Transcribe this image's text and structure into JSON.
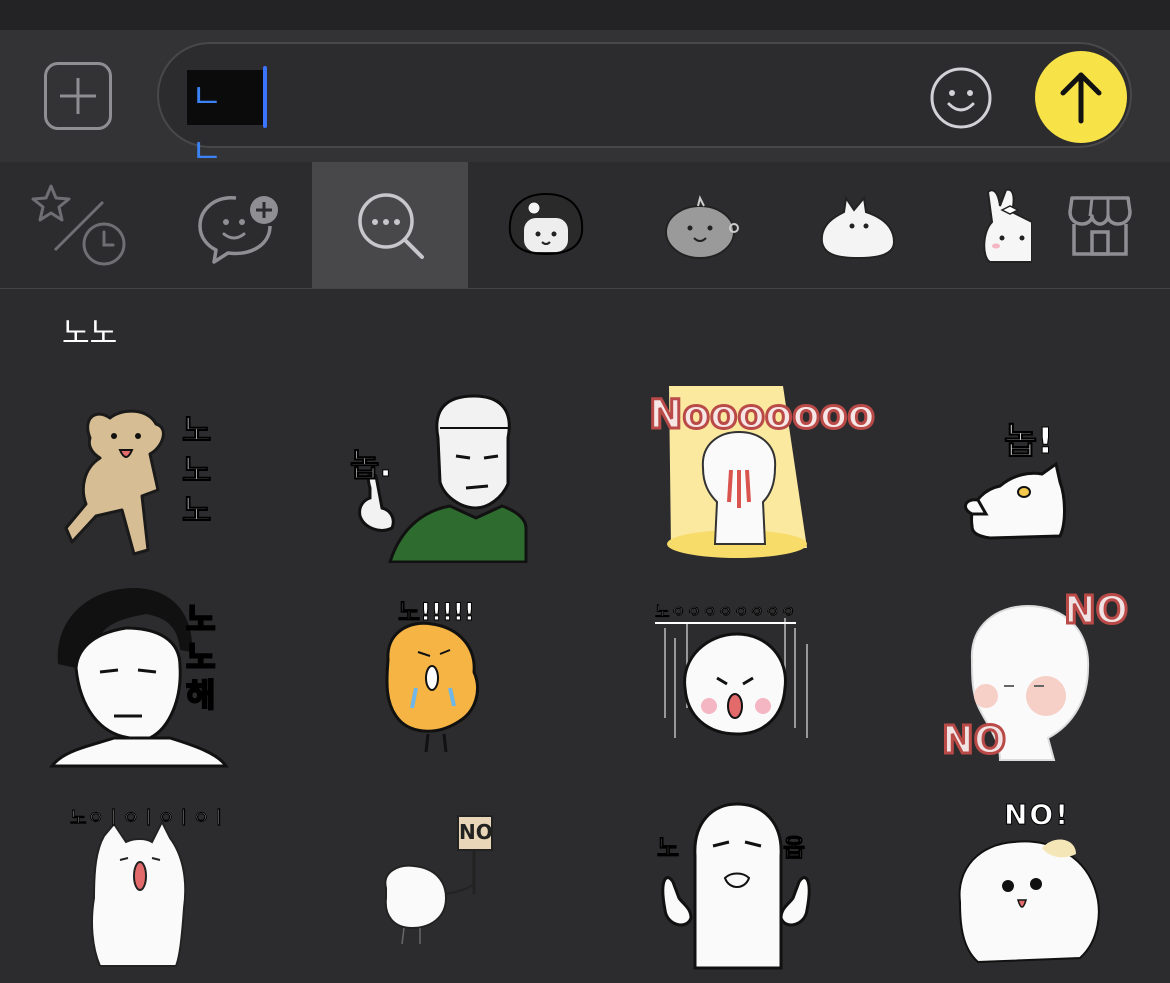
{
  "composer": {
    "input_value": "ㄴㄴ",
    "send_color": "#f7e247",
    "accent_caret": "#3b74ff"
  },
  "tabs": [
    {
      "name": "recent-favorites",
      "icon": "star-clock-icon"
    },
    {
      "name": "emoticon-add",
      "icon": "chat-face-plus-icon"
    },
    {
      "name": "search",
      "icon": "search-chat-icon",
      "active": true
    },
    {
      "name": "pack-1",
      "icon": "girl-sticker-icon"
    },
    {
      "name": "pack-2",
      "icon": "gray-blob-sticker-icon"
    },
    {
      "name": "pack-3",
      "icon": "white-blob-sticker-icon"
    },
    {
      "name": "pack-4",
      "icon": "bunny-sticker-icon"
    },
    {
      "name": "store",
      "icon": "store-icon"
    }
  ],
  "section_title": "노노",
  "stickers": [
    {
      "caption": "노노노"
    },
    {
      "caption": "놉."
    },
    {
      "caption": "Nooooooo"
    },
    {
      "caption": "놉!"
    },
    {
      "caption": "노노해"
    },
    {
      "caption": "노!!!!!"
    },
    {
      "caption": "노ㅇㅇㅇㅇㅇㅇㅇㅇ"
    },
    {
      "caption": "NO",
      "caption2": "NO"
    },
    {
      "caption": "노ㅇㅣㅇㅣㅇㅣㅇㅣ"
    },
    {
      "caption": "NO"
    },
    {
      "caption": "노",
      "caption2": "옵"
    },
    {
      "caption": "NO!"
    }
  ]
}
